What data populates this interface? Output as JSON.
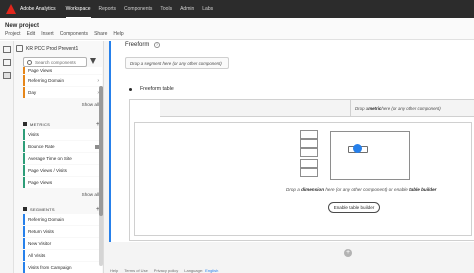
{
  "topbar": {
    "brand": "Adobe Analytics",
    "nav": [
      "Workspace",
      "Reports",
      "Components",
      "Tools",
      "Admin",
      "Labs"
    ],
    "active_index": 0
  },
  "project": {
    "title": "New project",
    "menu": [
      "Project",
      "Edit",
      "Insert",
      "Components",
      "Share",
      "Help"
    ]
  },
  "panel": {
    "report_suite": "KR PCC Prod Prevent1",
    "search_placeholder": "Search components",
    "dimensions": {
      "items": [
        "Page Views",
        "Referring Domain",
        "Day"
      ],
      "show_all": "Show all"
    },
    "metrics": {
      "header": "METRICS",
      "items": [
        "Visits",
        "Bounce Rate",
        "Average Time on Site",
        "Page Views / Visits",
        "Page Views"
      ],
      "show_all": "Show all"
    },
    "segments": {
      "header": "SEGMENTS",
      "items": [
        "Referring Domain",
        "Return Visits",
        "New Visitor",
        "All Visits",
        "Visits from Campaign"
      ]
    }
  },
  "workspace": {
    "panel_title": "Freeform",
    "info_icon": "?",
    "drop_segment": "Drop a segment here (or any other component)",
    "table_title": "Freeform table",
    "drop_metric_pre": "Drop a ",
    "drop_metric_bold": "metric",
    "drop_metric_post": " here (or any other component)",
    "drop_dim_pre": "Drop a ",
    "drop_dim_bold1": "dimension",
    "drop_dim_mid": " here (or any other component) or enable ",
    "drop_dim_bold2": "table builder",
    "enable_button": "Enable table builder",
    "add_panel": "+"
  },
  "footer": {
    "links": [
      "Help",
      "Terms of Use",
      "Privacy policy"
    ],
    "language_label": "Language:",
    "language": "English"
  },
  "colors": {
    "accent": "#2680eb",
    "dimension": "#e68619",
    "metric": "#2d9d78",
    "segment": "#2680eb",
    "topbar": "#2c2c2c",
    "logo": "#e1251b"
  }
}
